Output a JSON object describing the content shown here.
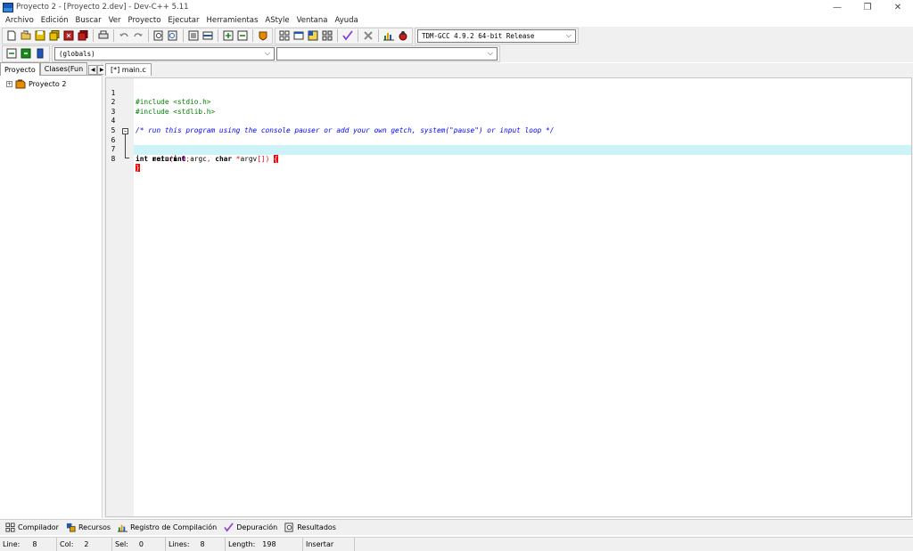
{
  "window": {
    "title": "Proyecto 2 - [Proyecto 2.dev] - Dev-C++ 5.11",
    "controls": {
      "minimize": "—",
      "restore": "❐",
      "close": "✕"
    }
  },
  "menu": [
    "Archivo",
    "Edición",
    "Buscar",
    "Ver",
    "Proyecto",
    "Ejecutar",
    "Herramientas",
    "AStyle",
    "Ventana",
    "Ayuda"
  ],
  "toolbar": {
    "compiler_select": "TDM-GCC 4.9.2 64-bit Release",
    "scope_select": "(globals)",
    "member_select": ""
  },
  "left_panel": {
    "tabs": [
      "Proyecto",
      "Clases(Fun"
    ],
    "active_tab": "Proyecto",
    "tree_root": "Proyecto 2"
  },
  "editor": {
    "tab_label": "[*] main.c",
    "current_line": 8,
    "lines": [
      {
        "n": "1",
        "text": "#include <stdio.h>"
      },
      {
        "n": "2",
        "text": "#include <stdlib.h>"
      },
      {
        "n": "3",
        "text": ""
      },
      {
        "n": "4",
        "text": "/* run this program using the console pauser or add your own getch, system(\"pause\") or input loop */"
      },
      {
        "n": "5",
        "text": ""
      },
      {
        "n": "6",
        "text": "int main(int argc, char *argv[]) {"
      },
      {
        "n": "7",
        "text": "    return 0;"
      },
      {
        "n": "8",
        "text": "}"
      }
    ],
    "tokens": {
      "l6_kw1": "int",
      "l6_fn": " main",
      "l6_p1": "(",
      "l6_kw2": "int",
      "l6_a1": " argc",
      "l6_comma": ",",
      "l6_kw3": " char",
      "l6_star": " *",
      "l6_a2": "argv",
      "l6_br": "[]",
      "l6_p2": ")",
      "l6_brace": "{",
      "l7_kw": "return",
      "l7_num": "0",
      "l7_semi": ";",
      "l8_brace": "}"
    }
  },
  "bottom_tabs": [
    {
      "label": "Compilador",
      "icon": "compiler-grid-icon"
    },
    {
      "label": "Recursos",
      "icon": "resources-icon"
    },
    {
      "label": "Registro de Compilación",
      "icon": "compile-log-chart-icon"
    },
    {
      "label": "Depuración",
      "icon": "debug-check-icon"
    },
    {
      "label": "Resultados",
      "icon": "search-results-icon"
    }
  ],
  "status": {
    "line_label": "Line:",
    "line": "8",
    "col_label": "Col:",
    "col": "2",
    "sel_label": "Sel:",
    "sel": "0",
    "lines_label": "Lines:",
    "lines": "8",
    "length_label": "Length:",
    "length": "198",
    "mode": "Insertar"
  },
  "colors": {
    "current_line": "#ccf4f8",
    "preprocessor": "#008000",
    "comment": "#0000ff",
    "symbol": "#ff0000",
    "number": "#800080"
  }
}
